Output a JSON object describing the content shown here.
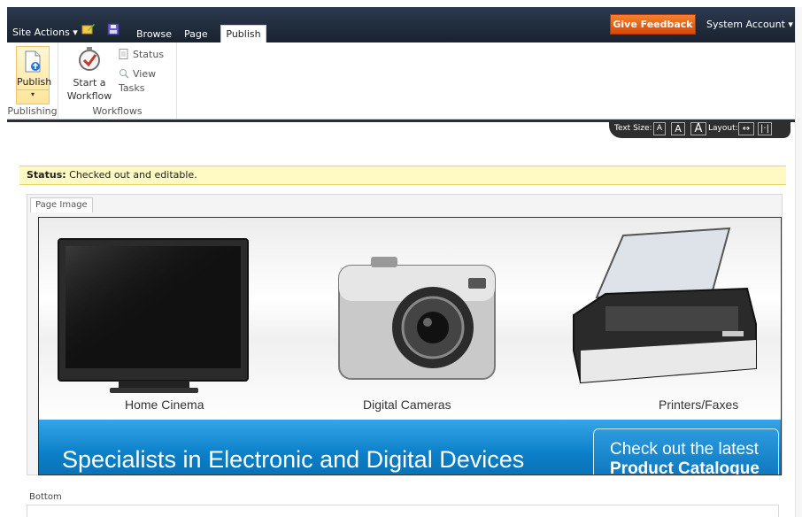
{
  "topbar": {
    "site_actions_label": "Site Actions ▾",
    "tabs": [
      {
        "label": "Browse"
      },
      {
        "label": "Page"
      },
      {
        "label": "Publish"
      }
    ],
    "feedback_label": "Give Feedback",
    "account_label": "System Account ▾"
  },
  "ribbon": {
    "publishing_group": {
      "publish_label": "Publish",
      "dropdown_arrow": "▾",
      "group_label": "Publishing"
    },
    "workflows_group": {
      "start_workflow_line1": "Start a",
      "start_workflow_line2": "Workflow",
      "status_label": "Status",
      "view_tasks_label": "View Tasks",
      "group_label": "Workflows"
    }
  },
  "textsize": {
    "text_size_label": "Text Size:",
    "sizes": [
      "A",
      "A",
      "A"
    ],
    "layout_label": "Layout:"
  },
  "status": {
    "prefix": "Status:",
    "text": " Checked out and editable."
  },
  "page_image": {
    "tab_label": "Page Image",
    "products": [
      {
        "label": "Home Cinema"
      },
      {
        "label": "Digital Cameras"
      },
      {
        "label": "Printers/Faxes"
      }
    ],
    "headline": "Specialists in Electronic and Digital Devices",
    "cta_line1": "Check out the latest",
    "cta_line2": "Product Catalogue"
  },
  "bottom": {
    "label": "Bottom"
  },
  "colors": {
    "topbar_bg": "#1e2938",
    "feedback_orange": "#e0561a",
    "status_yellow": "#fff9c4",
    "banner_blue": "#0b7fc8"
  }
}
